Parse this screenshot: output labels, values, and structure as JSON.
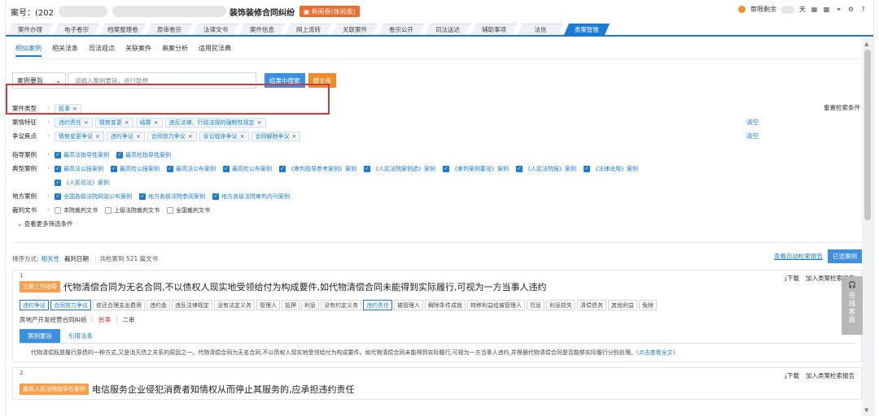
{
  "header": {
    "case_no": "案号：(202",
    "case_title": "装饰装修合同纠纷",
    "new_button": "新阅卷(体验版)",
    "review_label": "审限剩余",
    "review_unit": "天"
  },
  "tabs": [
    "案件办理",
    "电子卷宗",
    "档案整理卷",
    "原审卷宗",
    "法律文书",
    "案件信息",
    "网上流转",
    "关联案件",
    "卷宗公开",
    "司法送达",
    "辅助事项",
    "法信",
    "类案智推"
  ],
  "subnav": [
    "相似案例",
    "相关法条",
    "司法观点",
    "关联案件",
    "串案分析",
    "适用民法典"
  ],
  "search": {
    "select_label": "案例要旨",
    "placeholder": "请输入案例要旨，进行联想",
    "btn_inresult": "结果中搜索",
    "btn_all": "搜全库"
  },
  "filters": {
    "reset": "重置检索条件",
    "clear": "清空",
    "case_type": {
      "label": "案件类型",
      "chips": [
        "民事"
      ]
    },
    "features": {
      "label": "案情特征",
      "chips": [
        "违约责任",
        "情势变更",
        "结算",
        "违反法律、行政法规的强制性规定"
      ]
    },
    "issues": {
      "label": "争议焦点",
      "chips": [
        "情势变更争议",
        "违约争议",
        "合同效力争议",
        "诉讼程序争议",
        "合同解除争议"
      ]
    },
    "guiding": {
      "label": "指导案例",
      "options": [
        "最高法指导性案例",
        "最高检指导性案例"
      ]
    },
    "typical": {
      "label": "典型案例",
      "options": [
        "最高法公报案例",
        "最高检公报案例",
        "最高法公布案例",
        "最高检公布案例",
        "《审判指导参考案例》案例",
        "《人民法院案例选》案例",
        "《审判案例要览》案例",
        "《人民法院报》案例",
        "《法律适用》案例",
        "《人民司法》案例"
      ]
    },
    "local": {
      "label": "地方案例",
      "options": [
        "全国各级法院网站公布案例",
        "地方各级法院参阅案例",
        "地方各级法院审判内刊案例"
      ]
    },
    "judgment": {
      "label": "裁判文书",
      "options": [
        "本院裁判文书",
        "上级法院裁判文书",
        "全国裁判文书"
      ]
    },
    "more": "查看更多筛选条件"
  },
  "sort": {
    "label": "排序方式:",
    "by_relevance": "相关性",
    "by_date": "裁判日期",
    "count_text": "共检索到 521 篇文书",
    "report_link": "查看自动检索报告",
    "selected_btn": "已选案例"
  },
  "card1": {
    "num": "1",
    "download": "下载",
    "add_report": "加入类案检索报告",
    "badge": "立案工作指导",
    "title": "代物清偿合同为无名合同,不以债权人现实地受领给付为构成要件,如代物清偿合同未能得到实际履行,可视为一方当事人违约",
    "tags": [
      "违约争议",
      "合同效力争议",
      "依还合理支出费用",
      "违约金",
      "违反法律规定",
      "没有法定义务",
      "管理人",
      "抵押",
      "利息",
      "没有约定义务",
      "违约责任",
      "被管理人",
      "解除条件成就",
      "转移利益给被管理人",
      "罚息",
      "利息损失",
      "清偿债务",
      "其他利益",
      "免除"
    ],
    "highlight_tags": [
      "违约争议",
      "合同效力争议",
      "违约责任"
    ],
    "meta_type": "房地产开发经营合同纠纷",
    "meta_civil": "民事",
    "meta_level": "二审",
    "tab1": "案例要旨",
    "tab2": "引用法条",
    "summary": "代物清偿既是履行原债的一种方式,又是消灭债之关系的原因之一。代物清偿合同为无名合同,不以债权人现实地受领给付为构成要件。如代物清偿合同未能得到实际履行,可视为一方当事人违约,并根据代物清偿合同是否能够实际履行分别处理。",
    "summary_more": "(点击查看全文)"
  },
  "card2": {
    "num": "2",
    "download": "下载",
    "add_report": "加入类案检索报告",
    "badge": "最高人民法院指导性案例",
    "title": "电信服务企业侵犯消费者知情权从而停止其服务的,应承担违约责任"
  },
  "online": {
    "top": "在",
    "text": "线客服"
  }
}
